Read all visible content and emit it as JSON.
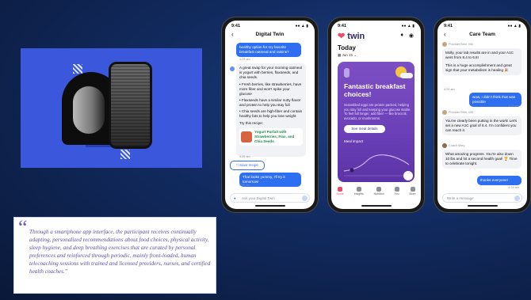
{
  "quote": {
    "text": "Through a smartphone app interface, the participant receives continually adapting, personalized recommendations about food choices, physical activity, sleep hygiene, and deep breathing exercises that are curated by personal preferences and reinforced through periodic, mainly front-loaded, human telecoaching sessions with trained and licensed providers, nurses, and certified health coaches.\"",
    "mark": "“"
  },
  "phone1": {
    "time": "9:41",
    "title": "Digital Twin",
    "msg_user": "healthy option for my favorite breakfast oatmeal and raisins?",
    "msg_user_time": "4:29 am",
    "reply_intro": "A great swap for your morning oatmeal is yogurt with berries, flaxseeds, and chia seeds.",
    "bullets": [
      "Fresh berries, like strawberries, have more fiber and won't spike your glucose",
      "Flaxseeds have a similar nutty flavor and protein to help you stay full",
      "Chia seeds are high-fiber and contain healthy fats to help you lose weight"
    ],
    "try_text": "Try this recipe:",
    "recipe": "Yogurt Parfait with Strawberries, Flax, and Chia Seeds",
    "reply_time": "4:29 am",
    "save_label": "Save recipe",
    "msg_user2": "That looks yummy, I'll try it tomorrow!",
    "msg_user2_time": "4:29 am",
    "input_placeholder": "Ask your Digital Twin"
  },
  "phone2": {
    "time": "9:41",
    "logo": "twin",
    "today": "Today",
    "date": "Jun 15",
    "card_title": "Fantastic breakfast choices!",
    "card_body": "Scrambled eggs are protein packed, helping you stay full and keeping your glucose stable. To feel full longer, add fiber — like broccoli, avocado, or mushrooms.",
    "card_button": "See meal details",
    "meal_impact": "Meal impact",
    "tabs": [
      "Home",
      "Insights",
      "Nutrition",
      "You",
      "More"
    ]
  },
  "phone3": {
    "time": "9:41",
    "title": "Care Team",
    "sender1": "Provider Bree, MD",
    "msg1": "Molly, your lab results are in and your A1C went from 8.4 to 6.8!",
    "msg1b": "This is a huge accomplishment and great sign that your metabolism is healing 🎉",
    "msg1_time": "4:29 am",
    "reply1": "wow, I didn't think that was possible",
    "reply1_time": "4:29 am",
    "sender2": "Provider Bree, MD",
    "msg2": "You've clearly been putting in the work! Let's set a new A1C goal of 6.4. I'm confident you can reach it.",
    "sender3": "Coach Mary",
    "msg3": "What amazing progress. You're also down 10 lbs and hit a second health goal! 🏆 Time to celebrate tonight.",
    "reply2": "thanks everyone!",
    "reply2_time": "4:29 am",
    "input_placeholder": "Write a message"
  },
  "colors": {
    "accent": "#2d6ff0",
    "purple": "#6b3fb7",
    "hero": "#3b57dc",
    "quote": "#5d4fa8"
  }
}
